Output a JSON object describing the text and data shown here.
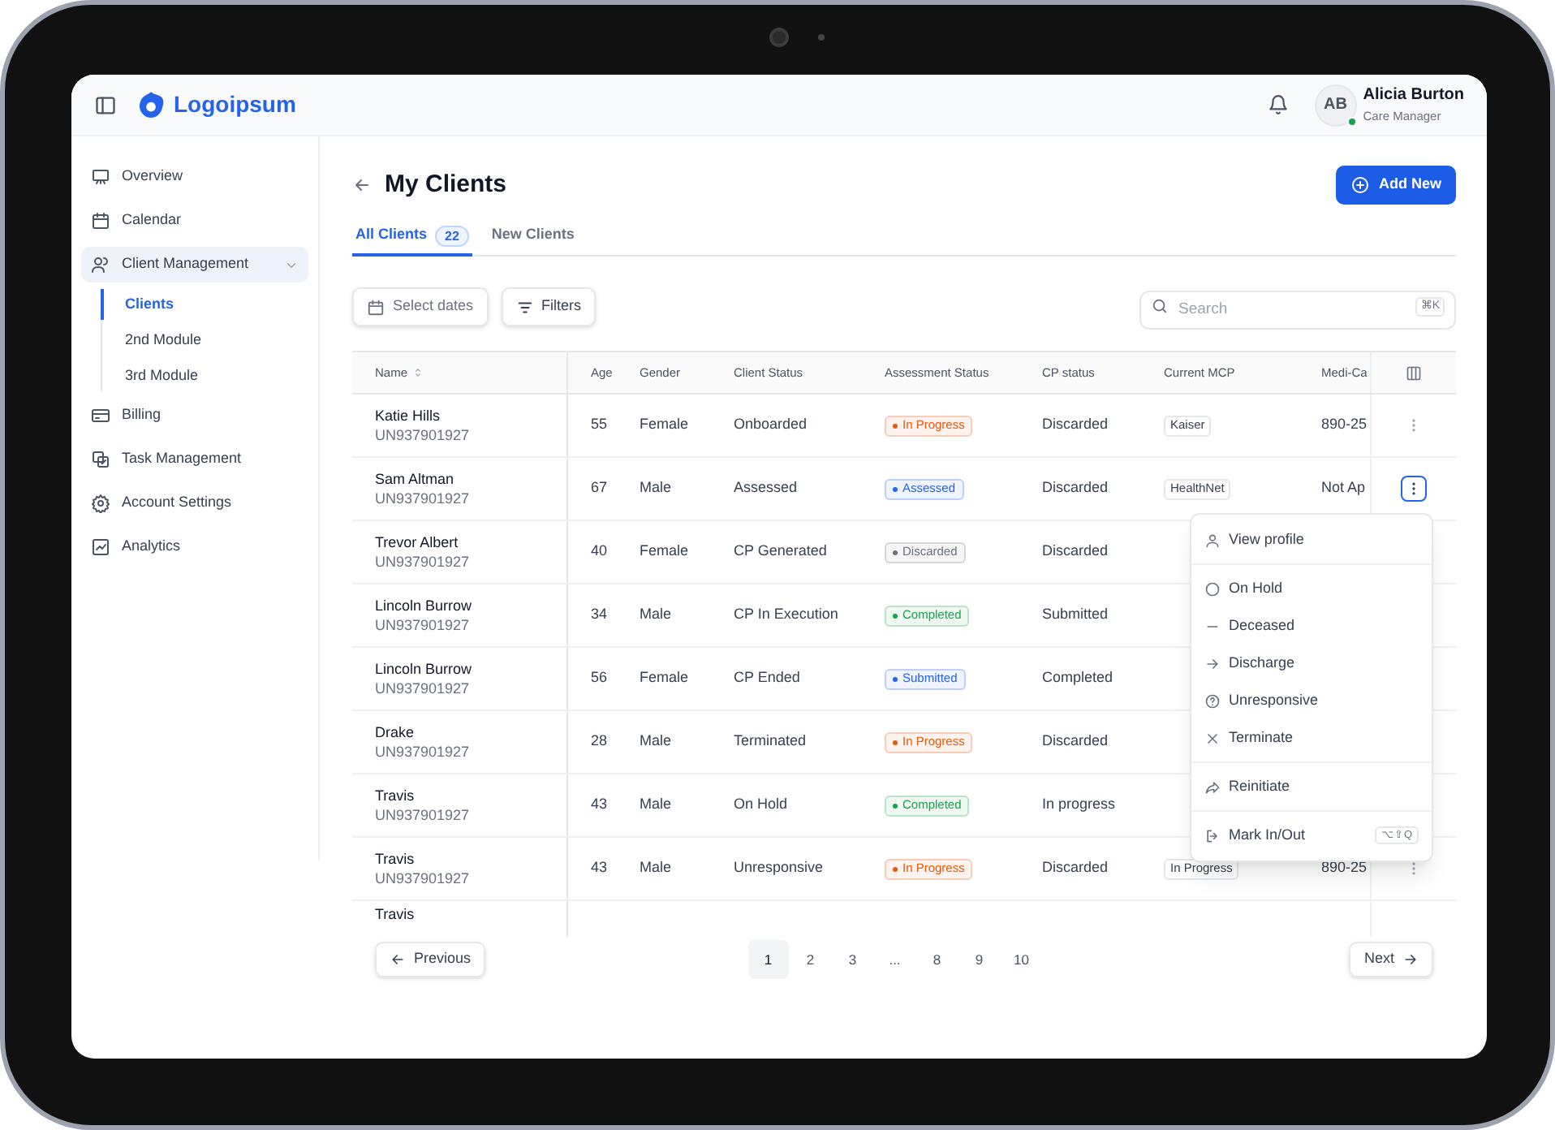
{
  "brand": "Logoipsum",
  "user": {
    "initials": "AB",
    "name": "Alicia Burton",
    "role": "Care Manager",
    "online": true
  },
  "sidebar": {
    "items": [
      {
        "label": "Overview",
        "selected": false
      },
      {
        "label": "Calendar",
        "selected": false
      },
      {
        "label": "Client Management",
        "selected": false,
        "expanded": true,
        "children": [
          {
            "label": "Clients",
            "selected": true
          },
          {
            "label": "2nd Module",
            "selected": false
          },
          {
            "label": "3rd Module",
            "selected": false
          }
        ]
      },
      {
        "label": "Billing",
        "selected": false
      },
      {
        "label": "Task Management",
        "selected": false
      },
      {
        "label": "Account Settings",
        "selected": false
      },
      {
        "label": "Analytics",
        "selected": false
      }
    ]
  },
  "page": {
    "title": "My Clients",
    "add_button": "Add New"
  },
  "tabs": [
    {
      "label": "All Clients",
      "count": "22",
      "selected": true
    },
    {
      "label": "New Clients",
      "selected": false
    }
  ],
  "toolbar": {
    "date_button": "Select dates",
    "filters_button": "Filters",
    "search": {
      "placeholder": "Search",
      "shortcut": "⌘K"
    }
  },
  "table": {
    "columns": [
      "Name",
      "Age",
      "Gender",
      "Client Status",
      "Assessment Status",
      "CP status",
      "Current MCP",
      "Medi-Ca"
    ],
    "rows": [
      {
        "name": "Katie Hills",
        "id": "UN937901927",
        "age": "55",
        "gender": "Female",
        "client_status": "Onboarded",
        "assessment": {
          "label": "In Progress",
          "color": "#ea580c"
        },
        "cp_status": "Discarded",
        "mcp": "Kaiser",
        "medi_cal": "890-25",
        "menu_open": false
      },
      {
        "name": "Sam Altman",
        "id": "UN937901927",
        "age": "67",
        "gender": "Male",
        "client_status": "Assessed",
        "assessment": {
          "label": "Assessed",
          "color": "#2563eb"
        },
        "cp_status": "Discarded",
        "mcp": "HealthNet",
        "medi_cal": "Not Ap",
        "menu_open": true
      },
      {
        "name": "Trevor Albert",
        "id": "UN937901927",
        "age": "40",
        "gender": "Female",
        "client_status": "CP Generated",
        "assessment": {
          "label": "Discarded",
          "color": "#6b7280"
        },
        "cp_status": "Discarded"
      },
      {
        "name": "Lincoln Burrow",
        "id": "UN937901927",
        "age": "34",
        "gender": "Male",
        "client_status": "CP In Execution",
        "assessment": {
          "label": "Completed",
          "color": "#16a34a"
        },
        "cp_status": "Submitted"
      },
      {
        "name": "Lincoln Burrow",
        "id": "UN937901927",
        "age": "56",
        "gender": "Female",
        "client_status": "CP Ended",
        "assessment": {
          "label": "Submitted",
          "color": "#2563eb"
        },
        "cp_status": "Completed"
      },
      {
        "name": "Drake",
        "id": "UN937901927",
        "age": "28",
        "gender": "Male",
        "client_status": "Terminated",
        "assessment": {
          "label": "In Progress",
          "color": "#ea580c"
        },
        "cp_status": "Discarded"
      },
      {
        "name": "Travis",
        "id": "UN937901927",
        "age": "43",
        "gender": "Male",
        "client_status": "On Hold",
        "assessment": {
          "label": "Completed",
          "color": "#16a34a"
        },
        "cp_status": "In progress"
      },
      {
        "name": "Travis",
        "id": "UN937901927",
        "age": "43",
        "gender": "Male",
        "client_status": "Unresponsive",
        "assessment": {
          "label": "In Progress",
          "color": "#ea580c"
        },
        "cp_status": "Discarded",
        "mcp": "In Progress",
        "medi_cal": "890-25",
        "menu_open": false
      },
      {
        "name": "Travis"
      }
    ]
  },
  "row_menu": {
    "groups": [
      [
        {
          "label": "View profile"
        }
      ],
      [
        {
          "label": "On Hold"
        },
        {
          "label": "Deceased"
        },
        {
          "label": "Discharge"
        },
        {
          "label": "Unresponsive"
        },
        {
          "label": "Terminate"
        }
      ],
      [
        {
          "label": "Reinitiate"
        }
      ],
      [
        {
          "label": "Mark In/Out",
          "shortcut": "⌥⇧Q"
        }
      ]
    ]
  },
  "pagination": {
    "previous": "Previous",
    "next": "Next",
    "pages": [
      {
        "label": "1",
        "selected": true
      },
      {
        "label": "2",
        "selected": false
      },
      {
        "label": "3",
        "selected": false
      },
      {
        "label": "...",
        "selected": false
      },
      {
        "label": "8",
        "selected": false
      },
      {
        "label": "9",
        "selected": false
      },
      {
        "label": "10",
        "selected": false
      }
    ]
  }
}
